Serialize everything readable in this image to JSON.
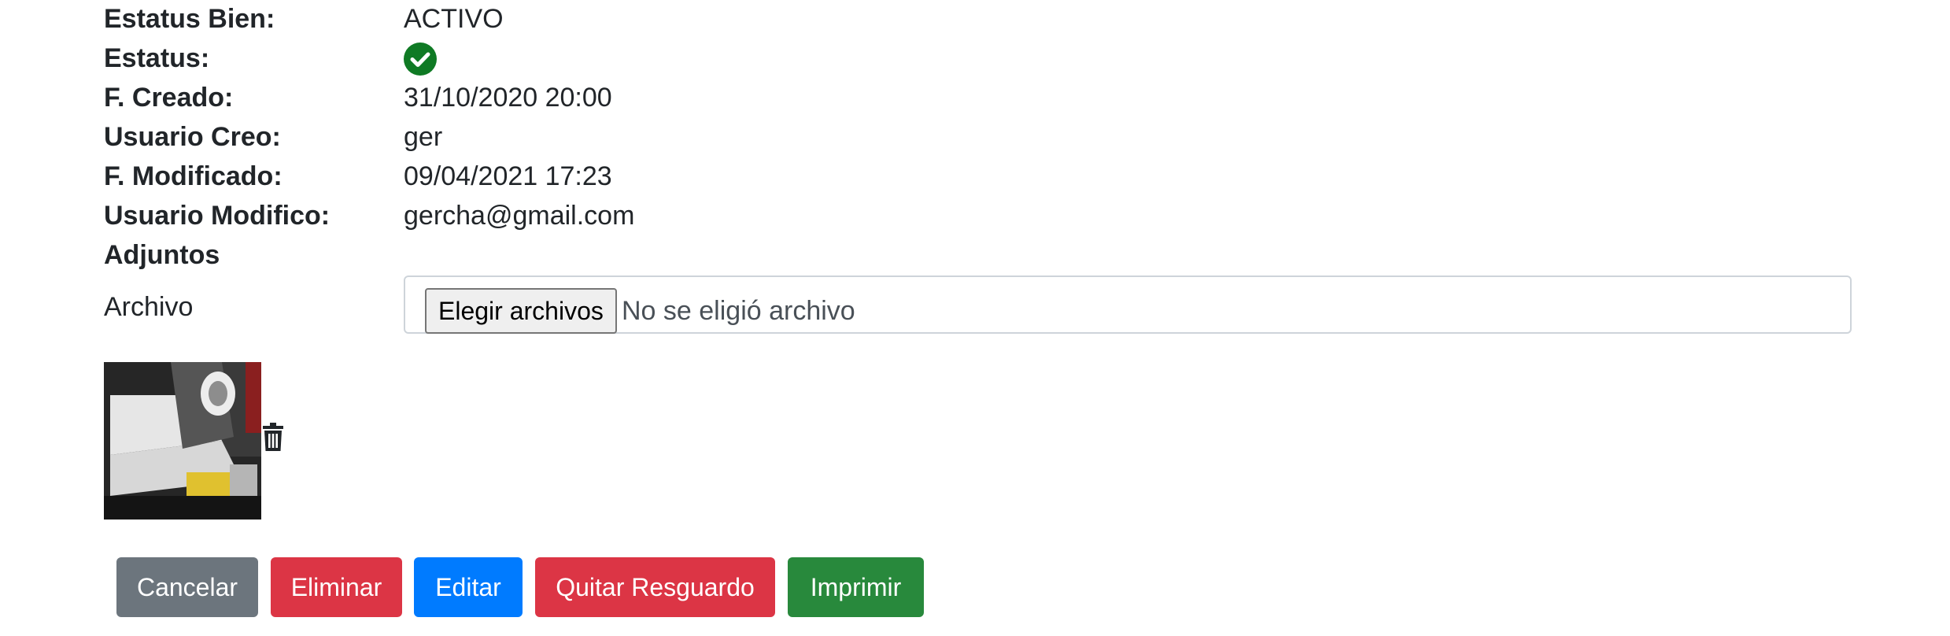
{
  "details": [
    {
      "label": "Estatus Bien:",
      "value": "ACTIVO"
    },
    {
      "label": "Estatus:",
      "value": null
    },
    {
      "label": "F. Creado:",
      "value": "31/10/2020 20:00"
    },
    {
      "label": "Usuario Creo:",
      "value": "ger"
    },
    {
      "label": "F. Modificado:",
      "value": "09/04/2021 17:23"
    },
    {
      "label": "Usuario Modifico:",
      "value": "gercha@gmail.com"
    }
  ],
  "status_icon": "check-circle-icon",
  "status_color": "#0f7a24",
  "attachments": {
    "heading": "Adjuntos",
    "file_label": "Archivo",
    "file_button": "Elegir archivos",
    "file_status": "No se eligió archivo",
    "delete_icon": "trash-icon"
  },
  "actions": {
    "cancel": "Cancelar",
    "delete": "Eliminar",
    "edit": "Editar",
    "remove_custody": "Quitar Resguardo",
    "print": "Imprimir"
  },
  "colors": {
    "secondary": "#6c757d",
    "danger": "#dc3545",
    "primary": "#007bff",
    "success": "#28893c"
  }
}
